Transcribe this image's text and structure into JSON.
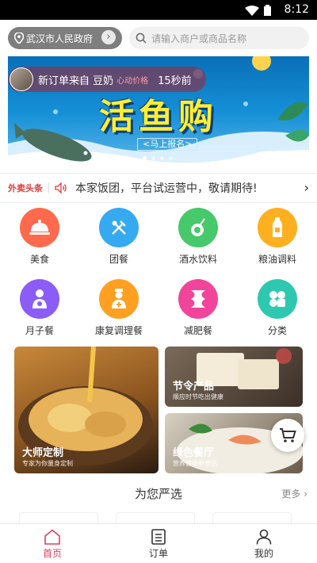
{
  "status": {
    "time": "8:12"
  },
  "header": {
    "location": "武汉市人民政府",
    "search_placeholder": "请输入商户或商品名称"
  },
  "banner": {
    "title": "活鱼购",
    "signup": "<马上报名>",
    "toast": {
      "message": "新订单来自 豆奶",
      "tag": "心动价格",
      "time_ago": "15秒前"
    }
  },
  "ticker": {
    "label": "外卖头条",
    "text": "本家饭团，平台试运营中，敬请期待!"
  },
  "categories": [
    {
      "label": "美食",
      "icon": "cloche-icon",
      "color": "#ff6a4d"
    },
    {
      "label": "团餐",
      "icon": "utensils-icon",
      "color": "#35aaf0"
    },
    {
      "label": "酒水饮料",
      "icon": "coconut-drink-icon",
      "color": "#45c96a"
    },
    {
      "label": "粮油调料",
      "icon": "oil-bottle-icon",
      "color": "#ffb020"
    },
    {
      "label": "月子餐",
      "icon": "mother-icon",
      "color": "#8b5cf6"
    },
    {
      "label": "康复调理餐",
      "icon": "nurse-icon",
      "color": "#ffa020"
    },
    {
      "label": "减肥餐",
      "icon": "waist-icon",
      "color": "#f0459a"
    },
    {
      "label": "分类",
      "icon": "grid-category-icon",
      "color": "#2ec8b0"
    }
  ],
  "promos": [
    {
      "title": "大师定制",
      "subtitle": "专家为你量身定制"
    },
    {
      "title": "节令产品",
      "subtitle": "顺应时节吃出健康"
    },
    {
      "title": "绿色餐厅",
      "subtitle": "营养健康新食选"
    }
  ],
  "section": {
    "title": "为您严选",
    "more": "更多"
  },
  "tabs": [
    {
      "label": "首页",
      "icon": "home-icon",
      "active": true
    },
    {
      "label": "订单",
      "icon": "orders-icon",
      "active": false
    },
    {
      "label": "我的",
      "icon": "profile-icon",
      "active": false
    }
  ],
  "colors": {
    "accent": "#e0405a",
    "ticker_label": "#e03a3a"
  }
}
